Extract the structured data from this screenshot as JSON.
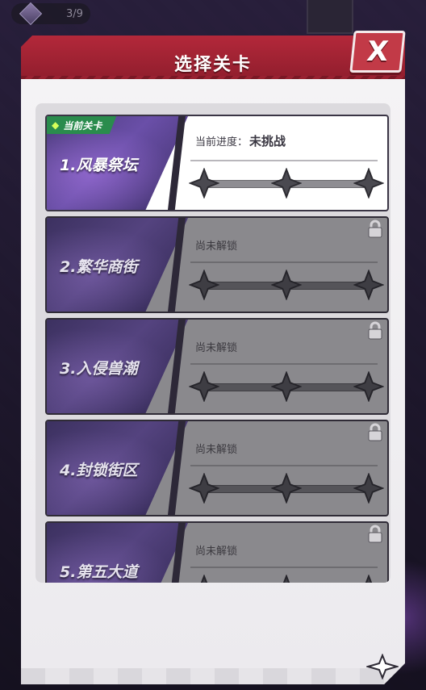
{
  "hud": {
    "progress_counter": "3/9"
  },
  "dialog": {
    "title": "选择关卡",
    "close_label": "X"
  },
  "stages": [
    {
      "name": "1.风暴祭坛",
      "badge": "当前关卡",
      "status_label": "当前进度：",
      "status_value": "未挑战",
      "locked": false,
      "stars_earned": 0,
      "stars_total": 3
    },
    {
      "name": "2.繁华商街",
      "status_label": "尚未解锁",
      "locked": true,
      "stars_earned": 0,
      "stars_total": 3
    },
    {
      "name": "3.入侵兽潮",
      "status_label": "尚未解锁",
      "locked": true,
      "stars_earned": 0,
      "stars_total": 3
    },
    {
      "name": "4.封锁街区",
      "status_label": "尚未解锁",
      "locked": true,
      "stars_earned": 0,
      "stars_total": 3
    },
    {
      "name": "5.第五大道",
      "status_label": "尚未解锁",
      "locked": true,
      "stars_earned": 0,
      "stars_total": 3
    }
  ],
  "colors": {
    "header_red": "#b3283a",
    "badge_green": "#2a8c4d",
    "locked_card": "#8a898d",
    "stage_art_purple": "#6a4fa8"
  }
}
